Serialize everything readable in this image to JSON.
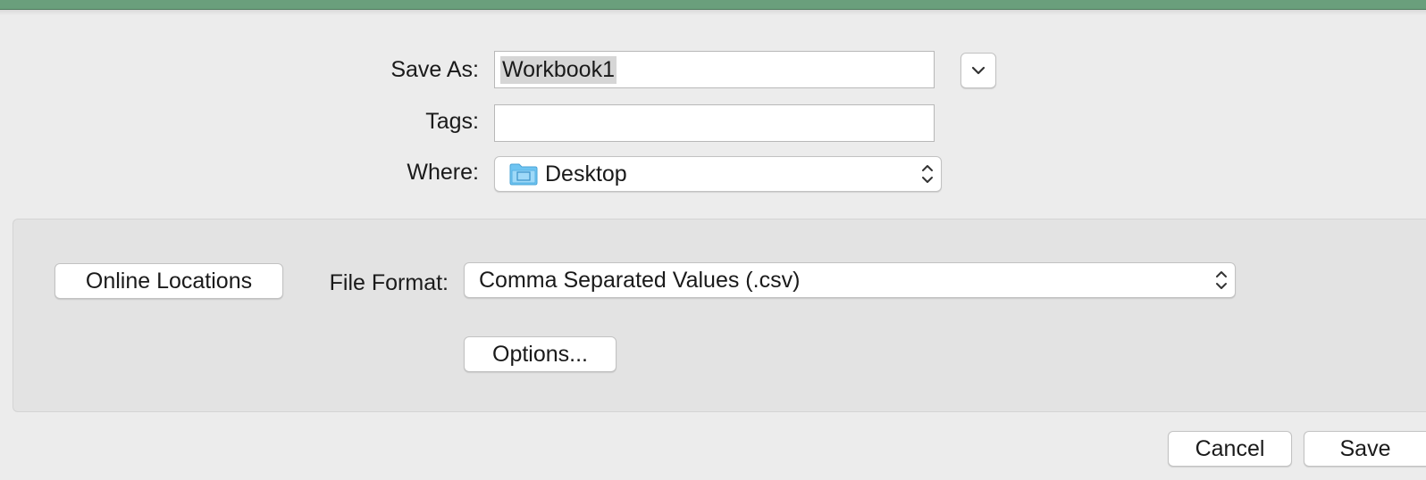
{
  "save_as": {
    "label": "Save As:",
    "value": "Workbook1"
  },
  "tags": {
    "label": "Tags:",
    "value": ""
  },
  "where": {
    "label": "Where:",
    "value": "Desktop",
    "icon": "folder-icon"
  },
  "expand_button": {
    "icon": "chevron-down-icon"
  },
  "options_panel": {
    "online_locations_label": "Online Locations",
    "file_format_label": "File Format:",
    "file_format_value": "Comma Separated Values (.csv)",
    "options_label": "Options..."
  },
  "footer": {
    "cancel_label": "Cancel",
    "save_label": "Save"
  },
  "colors": {
    "title_bar": "#6a9f7c",
    "dialog_background": "#ececec",
    "panel_background": "#e3e3e3",
    "folder_icon": "#6ec4f2"
  }
}
